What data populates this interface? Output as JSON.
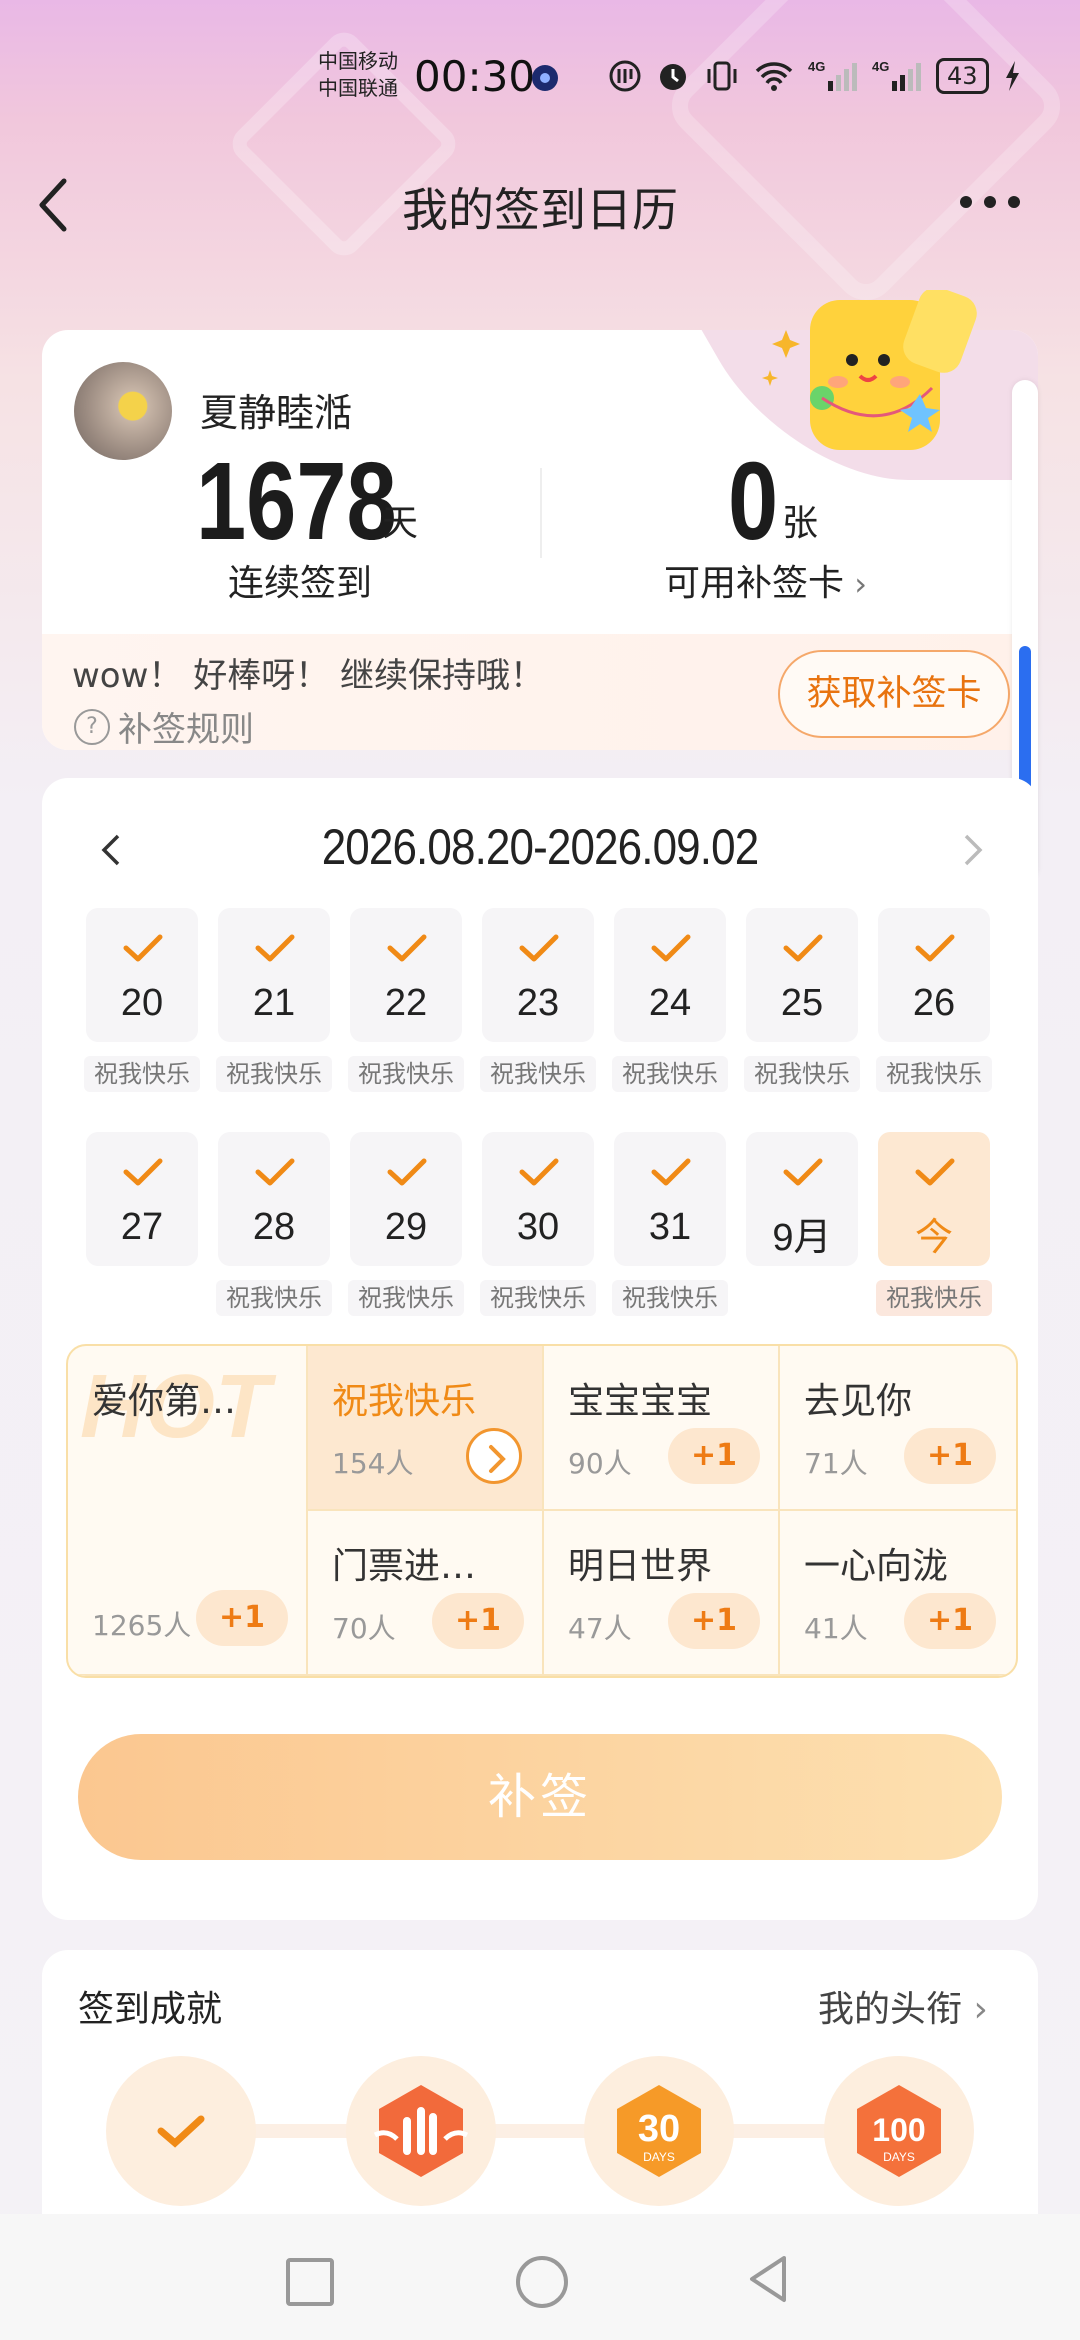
{
  "status_bar": {
    "carrier1": "中国移动",
    "carrier2": "中国联通",
    "time": "00:30",
    "battery": "43"
  },
  "header": {
    "title": "我的签到日历"
  },
  "profile": {
    "username": "夏静睦湉",
    "streak_days": "1678",
    "streak_unit": "天",
    "streak_label": "连续签到",
    "cards": "0",
    "cards_unit": "张",
    "cards_label": "可用补签卡",
    "message": "wow！ 好棒呀！ 继续保持哦！",
    "rules": "补签规则",
    "get_card_button": "获取补签卡"
  },
  "calendar": {
    "range": "2026.08.20-2026.09.02",
    "days": [
      {
        "label": "20",
        "tag": "祝我快乐",
        "today": false
      },
      {
        "label": "21",
        "tag": "祝我快乐",
        "today": false
      },
      {
        "label": "22",
        "tag": "祝我快乐",
        "today": false
      },
      {
        "label": "23",
        "tag": "祝我快乐",
        "today": false
      },
      {
        "label": "24",
        "tag": "祝我快乐",
        "today": false
      },
      {
        "label": "25",
        "tag": "祝我快乐",
        "today": false
      },
      {
        "label": "26",
        "tag": "祝我快乐",
        "today": false
      },
      {
        "label": "27",
        "tag": "",
        "today": false
      },
      {
        "label": "28",
        "tag": "祝我快乐",
        "today": false
      },
      {
        "label": "29",
        "tag": "祝我快乐",
        "today": false
      },
      {
        "label": "30",
        "tag": "祝我快乐",
        "today": false
      },
      {
        "label": "31",
        "tag": "祝我快乐",
        "today": false
      },
      {
        "label": "9月",
        "tag": "",
        "today": false
      },
      {
        "label": "今",
        "tag": "祝我快乐",
        "today": true
      }
    ]
  },
  "moods": {
    "hot_watermark": "HOT",
    "featured": {
      "title": "爱你第…",
      "count": "1265人",
      "plus": "+1"
    },
    "items": [
      {
        "title": "祝我快乐",
        "count": "154人",
        "plus": "",
        "selected": true
      },
      {
        "title": "宝宝宝宝",
        "count": "90人",
        "plus": "+1"
      },
      {
        "title": "去见你",
        "count": "71人",
        "plus": "+1"
      },
      {
        "title": "门票进…",
        "count": "70人",
        "plus": "+1"
      },
      {
        "title": "明日世界",
        "count": "47人",
        "plus": "+1"
      },
      {
        "title": "一心向泷",
        "count": "41人",
        "plus": "+1"
      }
    ]
  },
  "resign_button": "补签",
  "achievements": {
    "title": "签到成就",
    "link": "我的头衔",
    "badges": [
      "check-badge-icon",
      "hand-badge-icon",
      "30-days-badge-icon",
      "100-days-badge-icon"
    ]
  },
  "colors": {
    "accent": "#f08a16",
    "scroll_thumb": "#2b6ef0"
  }
}
